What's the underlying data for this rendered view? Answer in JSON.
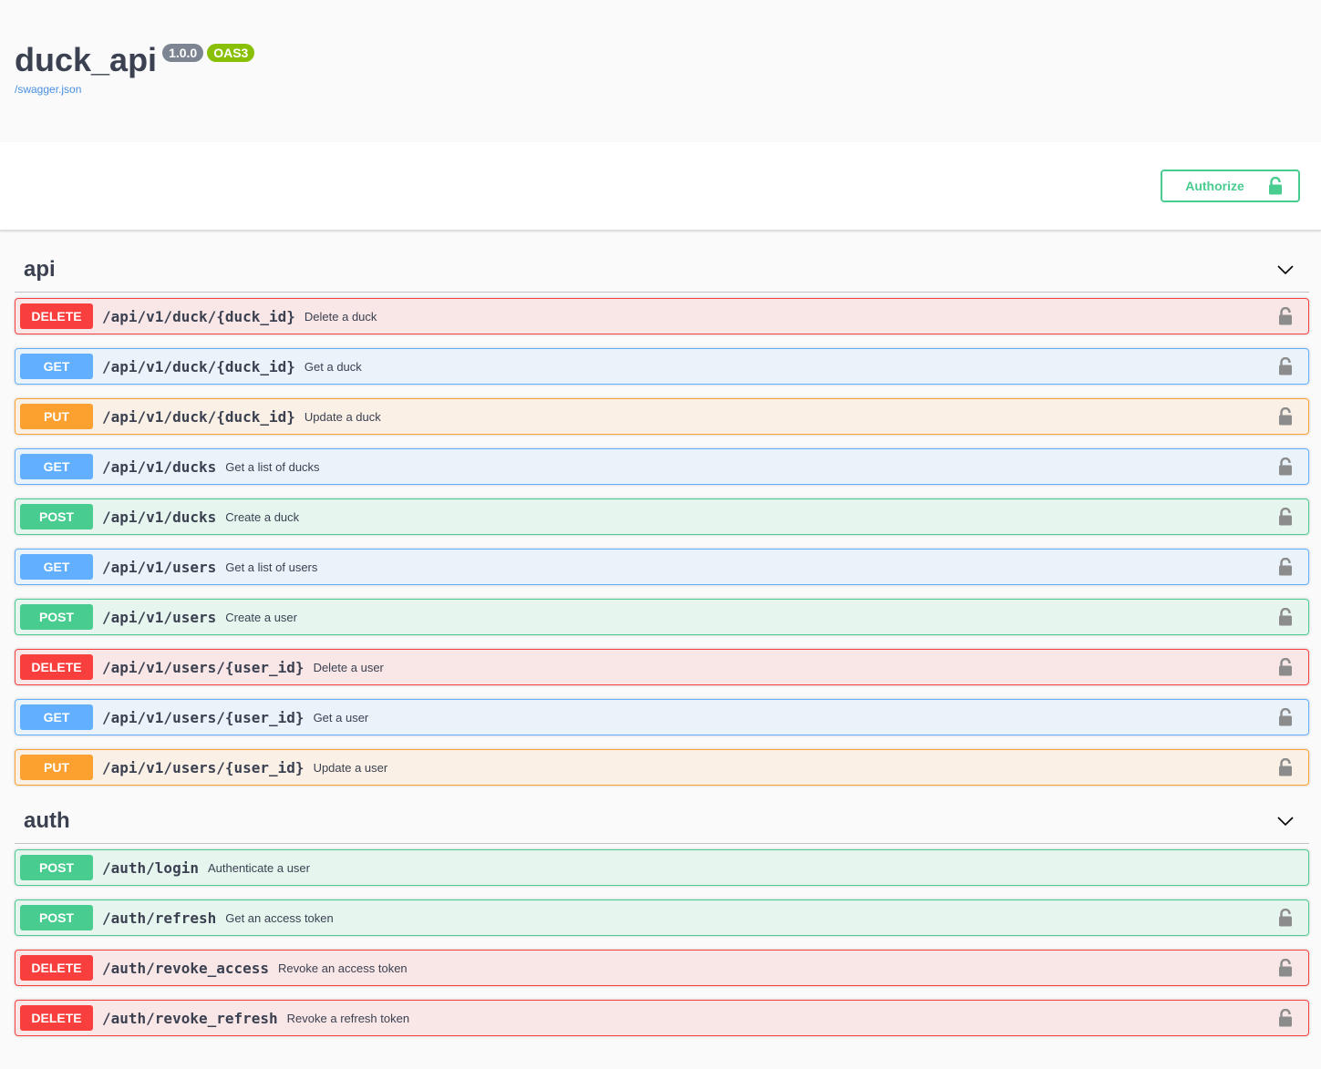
{
  "info": {
    "title": "duck_api",
    "version": "1.0.0",
    "oas_badge": "OAS3",
    "spec_link": "/swagger.json"
  },
  "scheme": {
    "authorize_label": "Authorize",
    "authorize_icon": "unlocked-padlock-icon"
  },
  "colors": {
    "delete": "#f93e3e",
    "get": "#61affe",
    "put": "#fca130",
    "post": "#49cc90",
    "authorize": "#49cc90"
  },
  "tags": [
    {
      "name": "api",
      "operations": [
        {
          "method": "DELETE",
          "path": "/api/v1/duck/{duck_id}",
          "summary": "Delete a duck",
          "locked": true
        },
        {
          "method": "GET",
          "path": "/api/v1/duck/{duck_id}",
          "summary": "Get a duck",
          "locked": true
        },
        {
          "method": "PUT",
          "path": "/api/v1/duck/{duck_id}",
          "summary": "Update a duck",
          "locked": true
        },
        {
          "method": "GET",
          "path": "/api/v1/ducks",
          "summary": "Get a list of ducks",
          "locked": true
        },
        {
          "method": "POST",
          "path": "/api/v1/ducks",
          "summary": "Create a duck",
          "locked": true
        },
        {
          "method": "GET",
          "path": "/api/v1/users",
          "summary": "Get a list of users",
          "locked": true
        },
        {
          "method": "POST",
          "path": "/api/v1/users",
          "summary": "Create a user",
          "locked": true
        },
        {
          "method": "DELETE",
          "path": "/api/v1/users/{user_id}",
          "summary": "Delete a user",
          "locked": true
        },
        {
          "method": "GET",
          "path": "/api/v1/users/{user_id}",
          "summary": "Get a user",
          "locked": true
        },
        {
          "method": "PUT",
          "path": "/api/v1/users/{user_id}",
          "summary": "Update a user",
          "locked": true
        }
      ]
    },
    {
      "name": "auth",
      "operations": [
        {
          "method": "POST",
          "path": "/auth/login",
          "summary": "Authenticate a user",
          "locked": false
        },
        {
          "method": "POST",
          "path": "/auth/refresh",
          "summary": "Get an access token",
          "locked": true
        },
        {
          "method": "DELETE",
          "path": "/auth/revoke_access",
          "summary": "Revoke an access token",
          "locked": true
        },
        {
          "method": "DELETE",
          "path": "/auth/revoke_refresh",
          "summary": "Revoke a refresh token",
          "locked": true
        }
      ]
    }
  ]
}
